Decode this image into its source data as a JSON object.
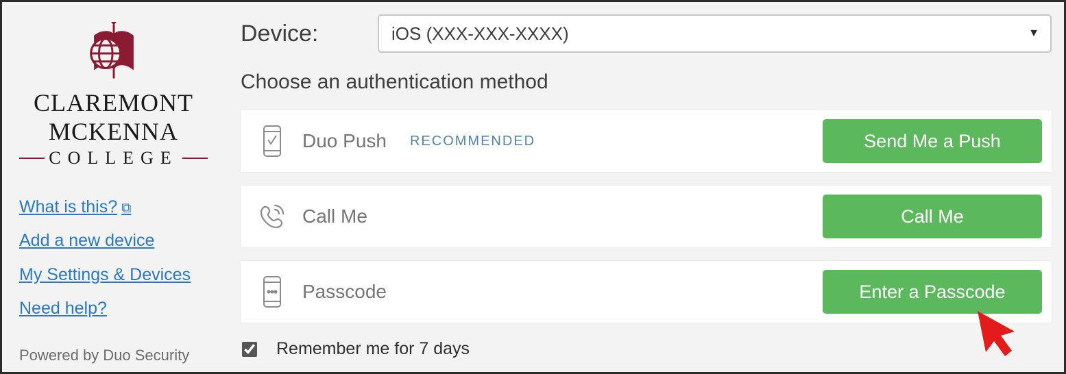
{
  "brand": {
    "line1": "CLAREMONT",
    "line2": "MCKENNA",
    "sub": "COLLEGE"
  },
  "links": {
    "what": "What is this?",
    "add": "Add a new device",
    "settings": "My Settings & Devices",
    "help": "Need help?"
  },
  "powered": "Powered by Duo Security",
  "device": {
    "label": "Device:",
    "selected": "iOS (XXX-XXX-XXXX)"
  },
  "choose_label": "Choose an authentication method",
  "methods": {
    "push": {
      "label": "Duo Push",
      "badge": "RECOMMENDED",
      "button": "Send Me a Push"
    },
    "call": {
      "label": "Call Me",
      "button": "Call Me"
    },
    "passcode": {
      "label": "Passcode",
      "button": "Enter a Passcode"
    }
  },
  "remember": {
    "label": "Remember me for 7 days",
    "checked": true
  }
}
